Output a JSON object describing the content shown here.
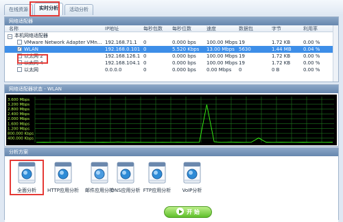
{
  "tabs": [
    "在线资源",
    "实时分析",
    "活动分析"
  ],
  "adapters_panel": {
    "title": "网络适配器",
    "columns": [
      "名称",
      "IP地址",
      "每秒包数",
      "每秒位数",
      "速度",
      "数据包",
      "字节",
      "利用率"
    ],
    "group_label": "本机网络适配器",
    "rows": [
      {
        "name": "VMware Network Adapter VMn...",
        "ip": "192.168.71.1",
        "pps": "0",
        "bps": "0.000 bps",
        "speed": "100.00 Mbps",
        "packets": "19",
        "bytes": "1.72 KB",
        "util": "0.00 %",
        "checked": false,
        "selected": false
      },
      {
        "name": "WLAN",
        "ip": "192.168.0.101",
        "pps": "0",
        "bps": "5.520 Kbps",
        "speed": "13.00 Mbps",
        "packets": "5630",
        "bytes": "1.44 MB",
        "util": "0.04 %",
        "checked": true,
        "selected": true
      },
      {
        "name": "以太网 2",
        "ip": "192.168.126.1",
        "pps": "0",
        "bps": "0.000 bps",
        "speed": "100.00 Mbps",
        "packets": "19",
        "bytes": "1.72 KB",
        "util": "0.00 %",
        "checked": false,
        "selected": false
      },
      {
        "name": "以太网 4",
        "ip": "192.168.104.1",
        "pps": "0",
        "bps": "0.000 bps",
        "speed": "100.00 Mbps",
        "packets": "19",
        "bytes": "1.72 KB",
        "util": "0.00 %",
        "checked": false,
        "selected": false
      },
      {
        "name": "以太网",
        "ip": "0.0.0.0",
        "pps": "0",
        "bps": "0.000 bps",
        "speed": "0.00 Mbps",
        "packets": "0",
        "bytes": "0 B",
        "util": "0.00 %",
        "checked": false,
        "selected": false
      }
    ]
  },
  "chart_panel": {
    "title": "网络适配器状态 - WLAN",
    "chart_data": {
      "type": "line",
      "yticks": [
        "3.600 Mbps",
        "3.200 Mbps",
        "2.800 Mbps",
        "2.400 Mbps",
        "2.000 Mbps",
        "1.600 Mbps",
        "1.200 Mbps",
        "800.000 Kbps",
        "400.000 Kbps"
      ],
      "ylim": [
        0,
        4000
      ],
      "yunit": "Kbps",
      "grid": true,
      "colors": {
        "background": "#000000",
        "grid": "#1f7a1f",
        "line": "#39ff14",
        "labels": "#b6ff4d"
      },
      "x": [
        0,
        5,
        10,
        15,
        20,
        25,
        30,
        35,
        40,
        45,
        50,
        55,
        60,
        65,
        70,
        75,
        80,
        85,
        90,
        95,
        100,
        105,
        110,
        115,
        120,
        125,
        130,
        135,
        140,
        145,
        150,
        155,
        160,
        165,
        170,
        175,
        180,
        185,
        190,
        195,
        200
      ],
      "y": [
        20,
        30,
        15,
        40,
        25,
        10,
        35,
        20,
        15,
        30,
        20,
        45,
        25,
        30,
        15,
        20,
        10,
        25,
        15,
        30,
        20,
        15,
        25,
        3300,
        60,
        20,
        40,
        30,
        20,
        25,
        400,
        30,
        20,
        35,
        25,
        20,
        30,
        15,
        25,
        20,
        30
      ]
    }
  },
  "analysis_panel": {
    "title": "分析方案",
    "schemes": [
      {
        "label": "全面分析",
        "icon": "full-analysis-icon"
      },
      {
        "label": "HTTP应用分析",
        "icon": "http-analysis-icon"
      },
      {
        "label": "邮件应用分析",
        "icon": "mail-analysis-icon"
      },
      {
        "label": "DNS应用分析",
        "icon": "dns-analysis-icon"
      },
      {
        "label": "FTP应用分析",
        "icon": "ftp-analysis-icon"
      },
      {
        "label": "VoIP分析",
        "icon": "voip-analysis-icon"
      }
    ],
    "start_label": "开 始"
  }
}
